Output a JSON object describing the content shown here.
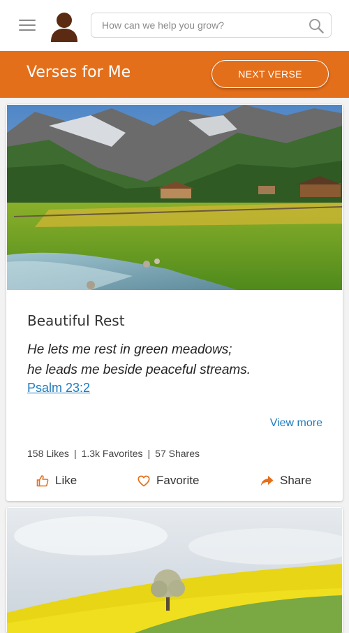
{
  "header": {
    "search_placeholder": "How can we help you grow?"
  },
  "banner": {
    "title": "Verses for Me",
    "next_label": "NEXT VERSE"
  },
  "card": {
    "title": "Beautiful Rest",
    "verse_line1": "He lets me rest in green meadows;",
    "verse_line2": "he leads me beside peaceful streams.",
    "reference": "Psalm 23:2",
    "view_more": "View more",
    "stats": {
      "likes": "158 Likes",
      "favorites": "1.3k Favorites",
      "shares": "57 Shares",
      "separator": "|"
    },
    "actions": {
      "like": "Like",
      "favorite": "Favorite",
      "share": "Share"
    }
  },
  "colors": {
    "brand_orange": "#e46f1b",
    "link_blue": "#1f7bbf"
  }
}
